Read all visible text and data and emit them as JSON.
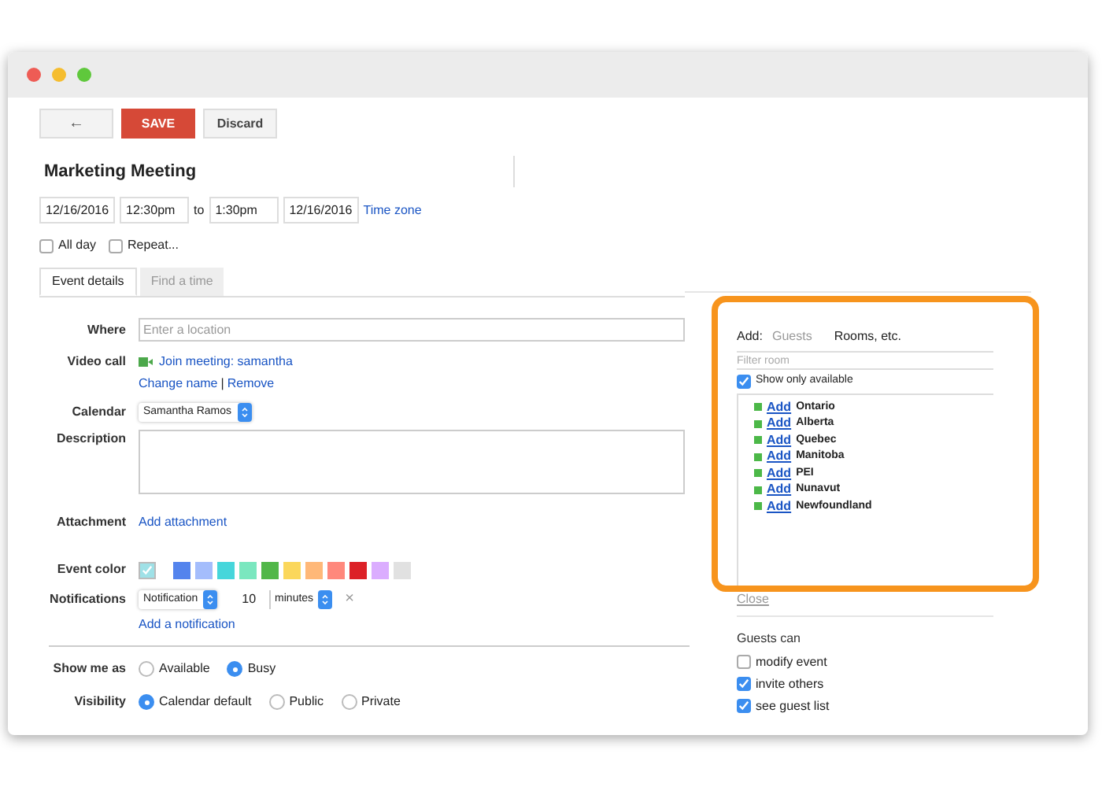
{
  "toolbar": {
    "back": "←",
    "save": "SAVE",
    "discard": "Discard"
  },
  "title": "Marketing Meeting",
  "dates": {
    "start_date": "12/16/2016",
    "start_time": "12:30pm",
    "to": "to",
    "end_time": "1:30pm",
    "end_date": "12/16/2016",
    "time_zone": "Time zone"
  },
  "options": [
    {
      "label": "All day",
      "checked": false
    },
    {
      "label": "Repeat...",
      "checked": false
    }
  ],
  "tabs": [
    {
      "label": "Event details",
      "selected": true
    },
    {
      "label": "Find a time",
      "selected": false
    }
  ],
  "where": {
    "label": "Where",
    "placeholder": "Enter a location"
  },
  "video_call": {
    "label": "Video call",
    "join": "Join meeting: samantha",
    "change": "Change name",
    "separator": "|",
    "remove": "Remove"
  },
  "calendar": {
    "label": "Calendar",
    "value": "Samantha Ramos"
  },
  "description": {
    "label": "Description"
  },
  "attachment": {
    "label": "Attachment",
    "link": "Add attachment"
  },
  "event_color": {
    "label": "Event color",
    "colors": [
      {
        "color": "#9fe1e7",
        "selected": true
      },
      {
        "color": "#5484ed",
        "selected": false
      },
      {
        "color": "#a4bdfc",
        "selected": false
      },
      {
        "color": "#46d6db",
        "selected": false
      },
      {
        "color": "#7ae7bf",
        "selected": false
      },
      {
        "color": "#51b749",
        "selected": false
      },
      {
        "color": "#fbd75b",
        "selected": false
      },
      {
        "color": "#ffb878",
        "selected": false
      },
      {
        "color": "#ff887c",
        "selected": false
      },
      {
        "color": "#dc2127",
        "selected": false
      },
      {
        "color": "#dbadff",
        "selected": false
      },
      {
        "color": "#e1e1e1",
        "selected": false
      }
    ]
  },
  "notifications": {
    "label": "Notifications",
    "type": "Notification",
    "amount": "10",
    "unit": "minutes",
    "remove": "×",
    "add": "Add a notification"
  },
  "show_me_as": {
    "label": "Show me as",
    "options": [
      {
        "label": "Available",
        "selected": false
      },
      {
        "label": "Busy",
        "selected": true
      }
    ]
  },
  "visibility": {
    "label": "Visibility",
    "options": [
      {
        "label": "Calendar default",
        "selected": true
      },
      {
        "label": "Public",
        "selected": false
      },
      {
        "label": "Private",
        "selected": false
      }
    ]
  },
  "add_panel": {
    "label": "Add:",
    "tabs": [
      {
        "label": "Guests",
        "selected": false
      },
      {
        "label": "Rooms, etc.",
        "selected": true
      }
    ],
    "filter_placeholder": "Filter room",
    "only_available": {
      "label": "Show only available",
      "checked": true
    },
    "rooms": [
      {
        "action": "Add",
        "name": "Ontario"
      },
      {
        "action": "Add",
        "name": "Alberta"
      },
      {
        "action": "Add",
        "name": "Quebec"
      },
      {
        "action": "Add",
        "name": "Manitoba"
      },
      {
        "action": "Add",
        "name": "PEI"
      },
      {
        "action": "Add",
        "name": "Nunavut"
      },
      {
        "action": "Add",
        "name": "Newfoundland"
      }
    ],
    "close": "Close"
  },
  "guests_can": {
    "title": "Guests can",
    "options": [
      {
        "label": "modify event",
        "checked": false
      },
      {
        "label": "invite others",
        "checked": true
      },
      {
        "label": "see guest list",
        "checked": true
      }
    ]
  }
}
